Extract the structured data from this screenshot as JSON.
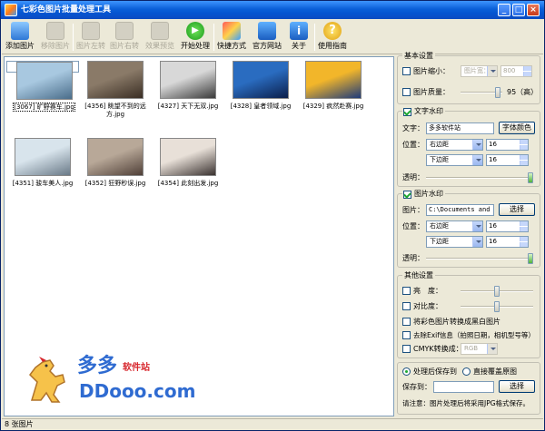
{
  "window": {
    "title": "七彩色图片批量处理工具"
  },
  "toolbar": [
    {
      "label": "添加图片",
      "icon": "add-image-icon",
      "enabled": true
    },
    {
      "label": "移除图片",
      "icon": "remove-image-icon",
      "enabled": false
    },
    {
      "label": "图片左转",
      "icon": "rotate-left-icon",
      "enabled": false
    },
    {
      "label": "图片右转",
      "icon": "rotate-right-icon",
      "enabled": false
    },
    {
      "label": "效果预览",
      "icon": "preview-icon",
      "enabled": false
    },
    {
      "label": "开始处理",
      "icon": "start-icon",
      "enabled": true
    },
    {
      "label": "快捷方式",
      "icon": "shortcut-icon",
      "enabled": true
    },
    {
      "label": "官方网站",
      "icon": "website-icon",
      "enabled": true
    },
    {
      "label": "关于",
      "icon": "about-icon",
      "enabled": true
    },
    {
      "label": "使用指南",
      "icon": "help-icon",
      "enabled": true
    }
  ],
  "images": [
    {
      "caption": "[3067] 旷野赛车.jpg",
      "colors": [
        "#a8c8e0",
        "#4a6d8a"
      ]
    },
    {
      "caption": "[4356] 眺望不到的远方.jpg",
      "colors": [
        "#8a7a68",
        "#3a2e24"
      ]
    },
    {
      "caption": "[4327] 天下无双.jpg",
      "colors": [
        "#d8d8d8",
        "#3a3a3a"
      ]
    },
    {
      "caption": "[4328] 皇者领域.jpg",
      "colors": [
        "#2a6cc0",
        "#0b1e4a"
      ]
    },
    {
      "caption": "[4329] 疯然赴赛.jpg",
      "colors": [
        "#f2b62a",
        "#1e3a7a"
      ]
    },
    {
      "caption": "[4351] 骏车美人.jpg",
      "colors": [
        "#d8e4ec",
        "#6a7a88"
      ]
    },
    {
      "caption": "[4352] 狂野秒误.jpg",
      "colors": [
        "#b8a898",
        "#504038"
      ]
    },
    {
      "caption": "[4354] 此刻出发.jpg",
      "colors": [
        "#e8e0d8",
        "#3a3230"
      ]
    }
  ],
  "logo": {
    "cn": "多多",
    "cn2": "软件站",
    "en": "DDooo.com"
  },
  "basic": {
    "title": "基本设置",
    "resize_label": "图片缩小：",
    "resize_mode": "图片宽：",
    "resize_value": "800",
    "quality_label": "图片质量：",
    "quality_value": "95（高）",
    "quality_level": 0.95
  },
  "text_watermark": {
    "title": "文字水印",
    "enabled": true,
    "text_label": "文字：",
    "text_value": "多多软件站",
    "font_color_button": "字体颜色",
    "position_label": "位置：",
    "h_pos": "右边距",
    "h_val": "16",
    "v_pos": "下边距",
    "v_val": "16",
    "opacity_label": "透明：",
    "opacity_level": 1.0
  },
  "image_watermark": {
    "title": "图片水印",
    "enabled": true,
    "image_label": "图片：",
    "image_path": "C:\\Documents and S",
    "choose_button": "选择",
    "position_label": "位置：",
    "h_pos": "右边距",
    "h_val": "16",
    "v_pos": "下边距",
    "v_val": "16",
    "opacity_label": "透明：",
    "opacity_level": 1.0
  },
  "other": {
    "title": "其他设置",
    "brightness_label": "亮　度：",
    "contrast_label": "对比度：",
    "grayscale_label": "将彩色图片转换成黑白图片",
    "exif_label": "去除Exif信息（拍照日期，相机型号等）",
    "cmyk_label": "CMYK转换成：",
    "cmyk_value": "RGB"
  },
  "save": {
    "opt1": "处理后保存到",
    "opt2": "直接覆盖原图",
    "save_label": "保存到：",
    "save_value": "",
    "choose_button": "选择",
    "note": "请注意：图片处理后将采用JPG格式保存。"
  },
  "status": {
    "text": "8 张图片"
  }
}
